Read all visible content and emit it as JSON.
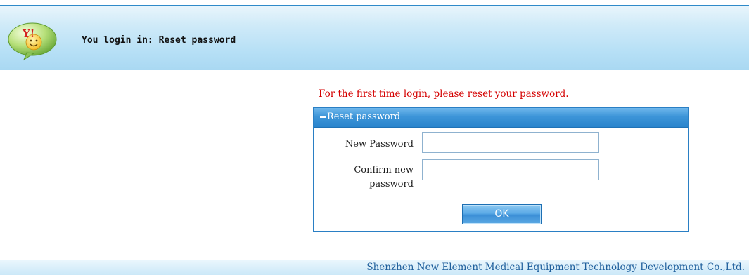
{
  "header": {
    "title": "You login in: Reset password",
    "logo_text": "Y!"
  },
  "notice": "For the first time login, please reset your password.",
  "panel": {
    "title": "Reset password",
    "new_password_label": "New Password",
    "confirm_password_label_line1": "Confirm new",
    "confirm_password_label_line2": "password",
    "new_password_value": "",
    "confirm_password_value": "",
    "ok_label": "OK"
  },
  "footer": {
    "company": "Shenzhen New Element Medical Equipment Technology Development Co.,Ltd."
  },
  "colors": {
    "accent": "#2a84cc",
    "notice_red": "#d40000",
    "footer_text": "#1f5f9c"
  }
}
